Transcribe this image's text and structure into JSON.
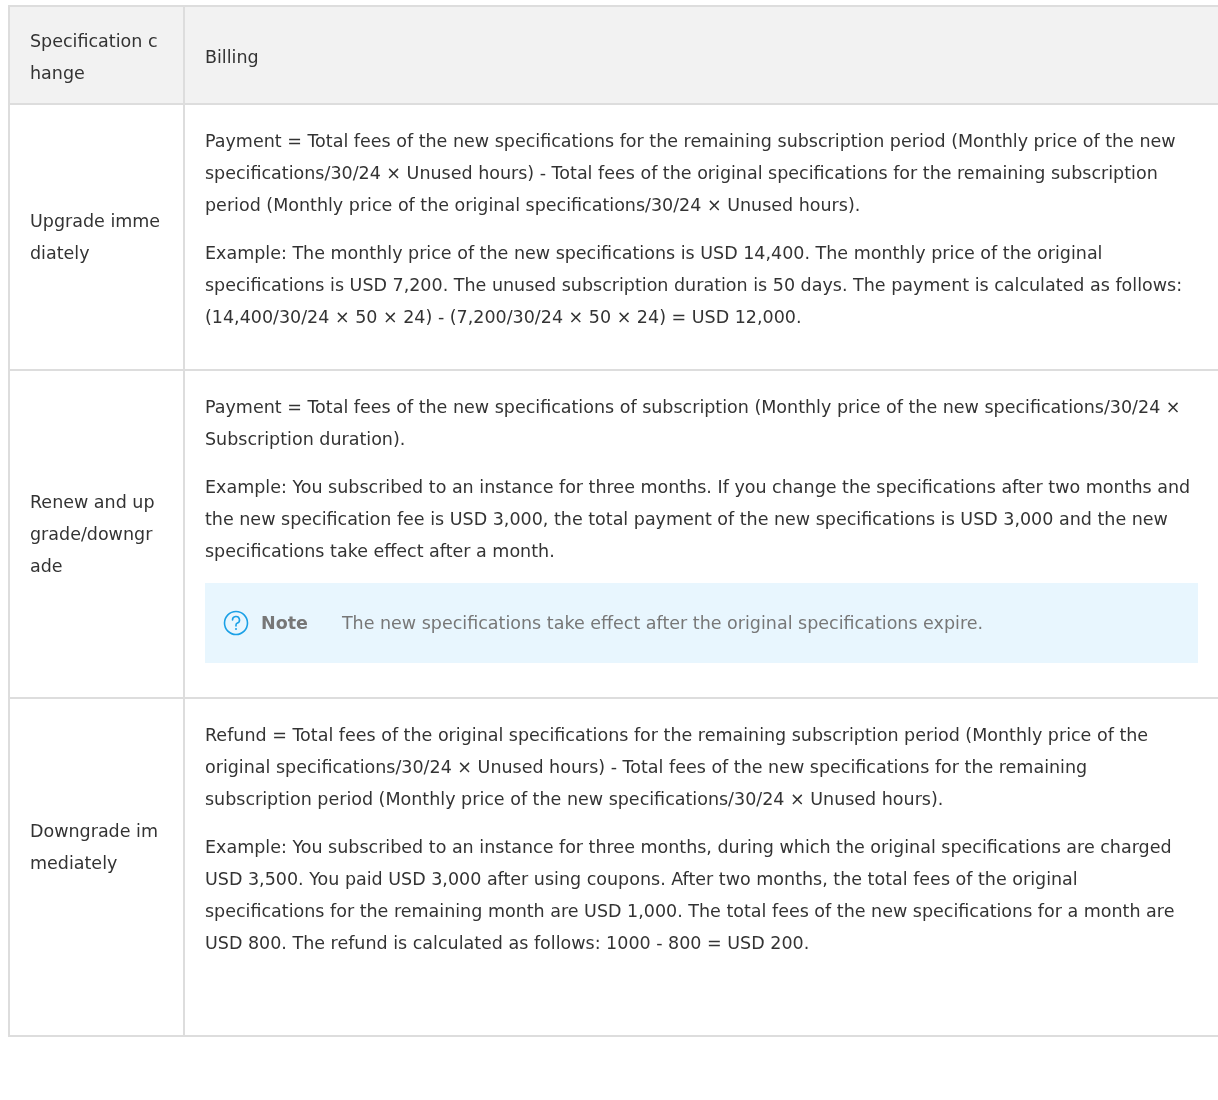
{
  "table": {
    "columns": [
      "Specification change",
      "Billing"
    ],
    "rows": [
      {
        "change": "Upgrade immediately",
        "paragraphs": [
          "Payment = Total fees of the new specifications for the remaining subscription period (Monthly price of the new specifications/30/24 × Unused hours) - Total fees of the original specifications for the remaining subscription period (Monthly price of the original specifications/30/24 × Unused hours).",
          "Example: The monthly price of the new specifications is USD 14,400. The monthly price of the original specifications is USD 7,200. The unused subscription duration is 50 days. The payment is calculated as follows: (14,400/30/24 × 50 × 24) - (7,200/30/24 × 50 × 24) = USD 12,000."
        ]
      },
      {
        "change": "Renew and upgrade/downgrade",
        "paragraphs": [
          "Payment = Total fees of the new specifications of subscription (Monthly price of the new specifications/30/24 × Subscription duration).",
          "Example: You subscribed to an instance for three months. If you change the specifications after two months and the new specification fee is USD 3,000, the total payment of the new specifications is USD 3,000 and the new specifications take effect after a month."
        ],
        "note": {
          "label": "Note",
          "text": "The new specifications take effect after the original specifications expire."
        }
      },
      {
        "change": "Downgrade immediately",
        "paragraphs": [
          "Refund = Total fees of the original specifications for the remaining subscription period (Monthly price of the original specifications/30/24 × Unused hours) - Total fees of the new specifications for the remaining subscription period (Monthly price of the new specifications/30/24 × Unused hours).",
          "Example: You subscribed to an instance for three months, during which the original specifications are charged USD 3,500. You paid USD 3,000 after using coupons. After two months, the total fees of the original specifications for the remaining month are USD 1,000. The total fees of the new specifications for a month are USD 800. The refund is calculated as follows: 1000 - 800 = USD 200."
        ]
      }
    ]
  }
}
